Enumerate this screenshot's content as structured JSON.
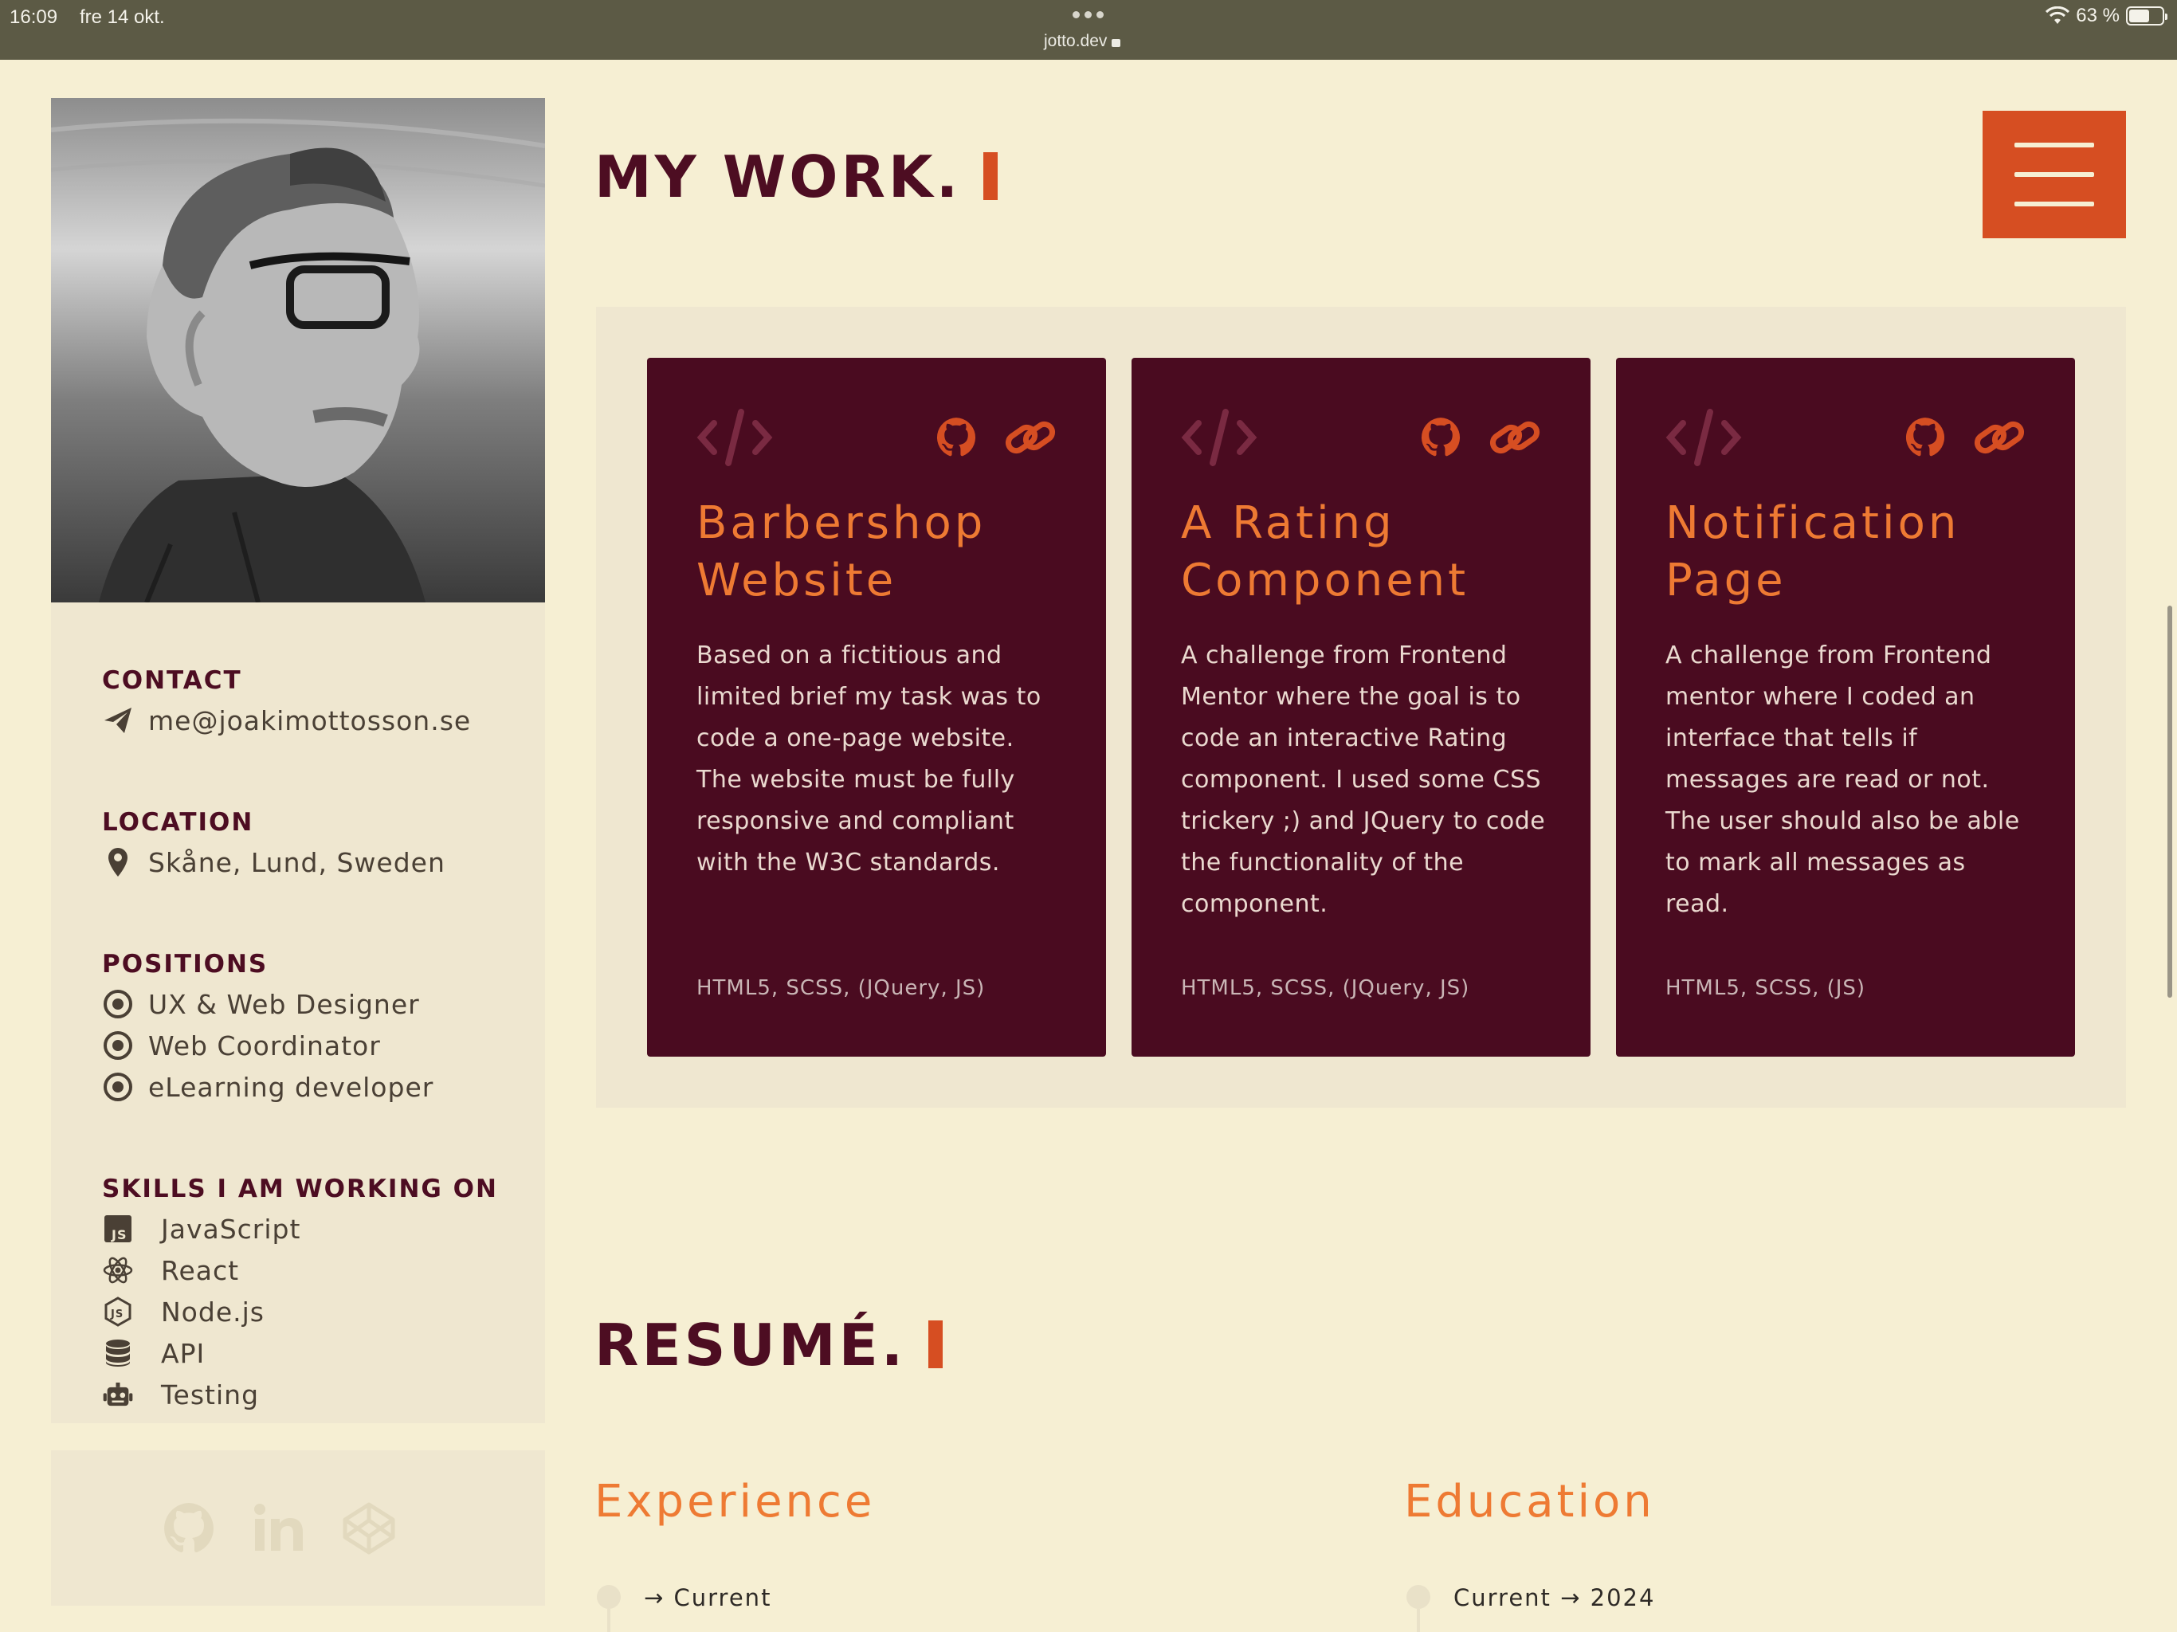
{
  "status_bar": {
    "time": "16:09",
    "date": "fre 14 okt.",
    "url": "jotto.dev",
    "battery": "63 %",
    "battery_level": 0.63
  },
  "sidebar": {
    "contact": {
      "heading": "CONTACT",
      "email": "me@joakimottosson.se"
    },
    "location": {
      "heading": "LOCATION",
      "value": "Skåne, Lund, Sweden"
    },
    "positions": {
      "heading": "POSITIONS",
      "items": [
        "UX & Web Designer",
        "Web Coordinator",
        "eLearning developer"
      ]
    },
    "skills": {
      "heading": "SKILLS I AM WORKING ON",
      "items": [
        {
          "label": "JavaScript",
          "icon": "js-icon"
        },
        {
          "label": "React",
          "icon": "react-icon"
        },
        {
          "label": "Node.js",
          "icon": "nodejs-icon"
        },
        {
          "label": "API",
          "icon": "database-icon"
        },
        {
          "label": "Testing",
          "icon": "robot-icon"
        }
      ]
    },
    "social": [
      "github-icon",
      "linkedin-icon",
      "codepen-icon"
    ]
  },
  "main": {
    "work_title": "MY WORK.",
    "projects": [
      {
        "title_line1": "Barbershop",
        "title_line2": "Website",
        "description": "Based on a fictitious and limited brief my task was to code a one-page website. The website must be fully responsive and compliant with the W3C standards.",
        "tech": "HTML5, SCSS, (JQuery, JS)"
      },
      {
        "title_line1": "A Rating",
        "title_line2": "Component",
        "description": "A challenge from Frontend Mentor where the goal is to code an interactive Rating component. I used some CSS trickery ;) and JQuery to code the functionality of the component.",
        "tech": "HTML5, SCSS, (JQuery, JS)"
      },
      {
        "title_line1": "Notification",
        "title_line2": "Page",
        "description": "A challenge from Frontend mentor where I coded an interface that tells if messages are read or not. The user should also be able to mark all messages as read.",
        "tech": "HTML5, SCSS, (JS)"
      }
    ],
    "resume_title": "RESUMÉ.",
    "experience": {
      "heading": "Experience",
      "first": "→ Current"
    },
    "education": {
      "heading": "Education",
      "first": "Current → 2024"
    }
  },
  "colors": {
    "background": "#f6efd3",
    "panel": "#efe7d0",
    "card": "#4a0b20",
    "accent": "#d64e22",
    "title_orange": "#ee7a33",
    "heading_maroon": "#4d0d22"
  }
}
